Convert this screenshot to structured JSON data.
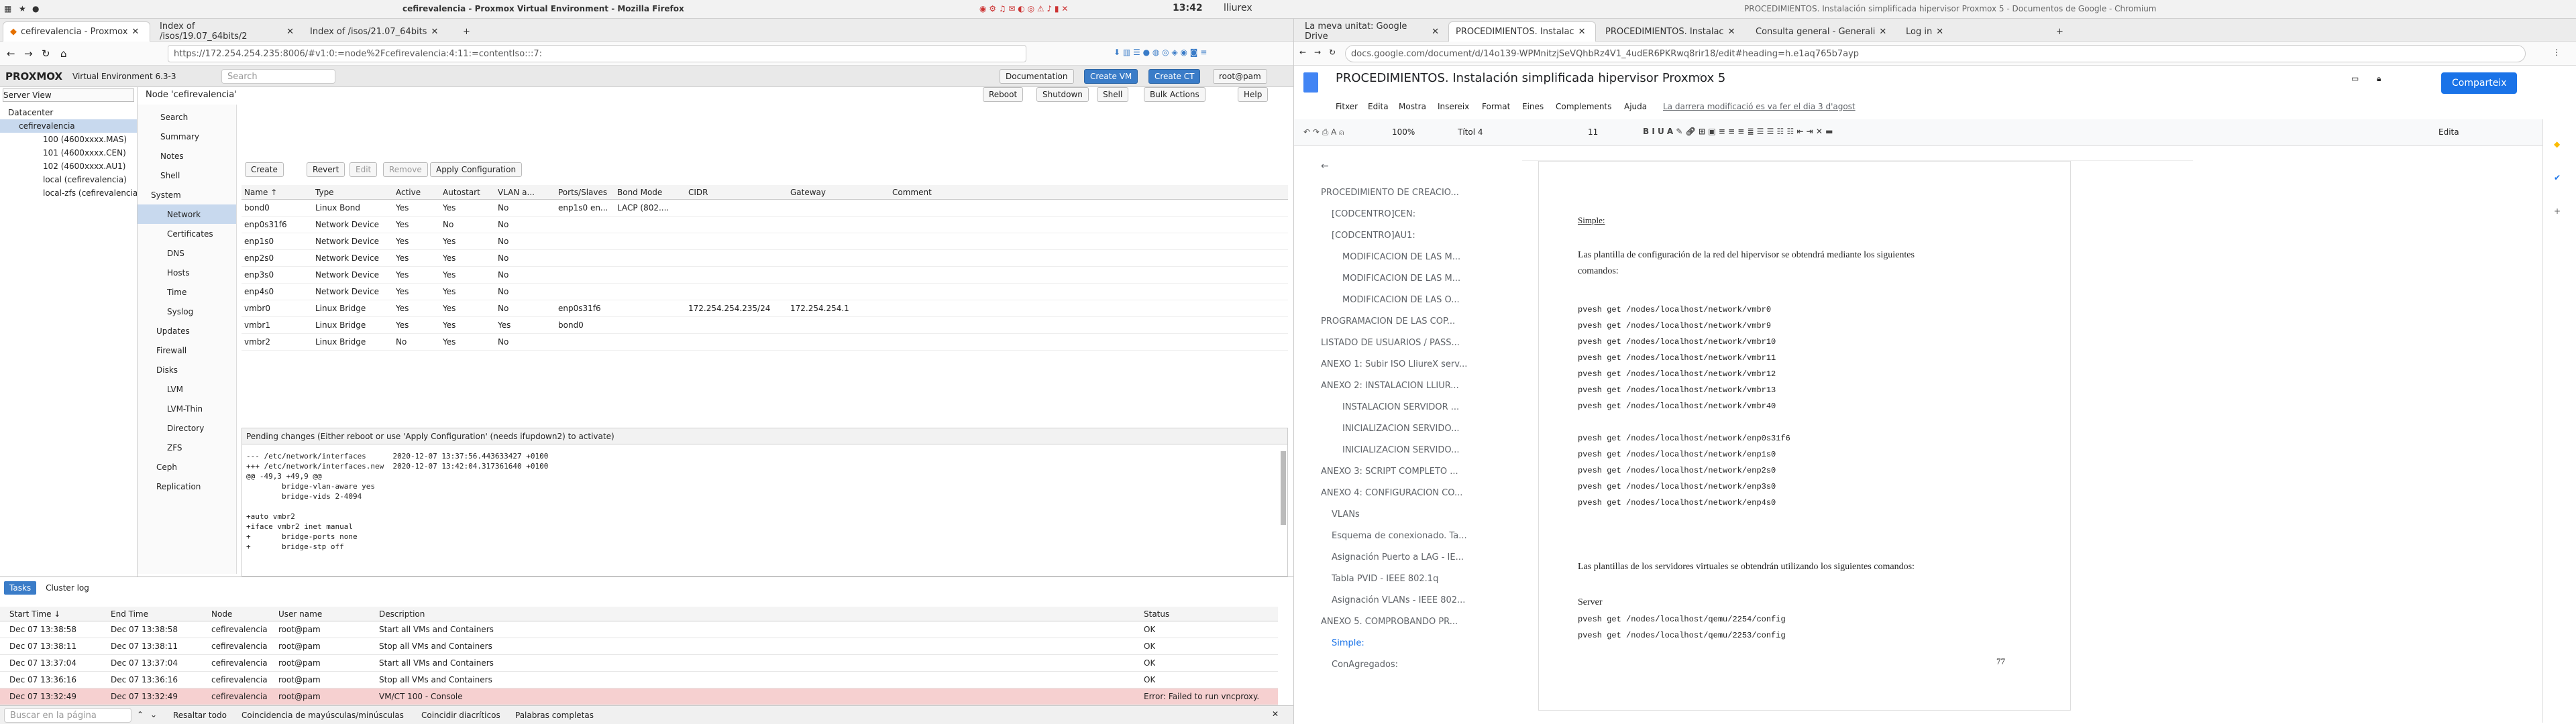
{
  "top_bar": {
    "clock": "13:42",
    "user": "lliurex",
    "window_title_left": "cefirevalencia - Proxmox Virtual Environment - Mozilla Firefox",
    "window_title_right": "PROCEDIMIENTOS. Instalación simplificada hipervisor Proxmox 5 - Documentos de Google - Chromium"
  },
  "firefox": {
    "tabs": [
      "cefirevalencia - Proxmox",
      "Index of /isos/19.07_64bits/2",
      "Index of /isos/21.07_64bits"
    ],
    "url": "https://172.254.254.235:8006/#v1:0:=node%2Fcefirevalencia:4:11:=contentIso:::7:",
    "pve": {
      "brand": "PROXMOX",
      "version": "Virtual Environment 6.3-3",
      "search_placeholder": "Search",
      "buttons": {
        "docs": "Documentation",
        "create_vm": "Create VM",
        "create_ct": "Create CT",
        "user": "root@pam",
        "reboot": "Reboot",
        "shutdown": "Shutdown",
        "shell": "Shell",
        "bulk": "Bulk Actions",
        "help": "Help"
      },
      "view": "Server View",
      "node_title": "Node 'cefirevalencia'",
      "tree": [
        "Datacenter",
        "cefirevalencia",
        "100 (4600xxxx.MAS)",
        "101 (4600xxxx.CEN)",
        "102 (4600xxxx.AU1)",
        "local (cefirevalencia)",
        "local-zfs (cefirevalencia)"
      ],
      "nav": [
        "Search",
        "Summary",
        "Notes",
        "Shell",
        "System",
        "Network",
        "Certificates",
        "DNS",
        "Hosts",
        "Time",
        "Syslog",
        "Updates",
        "Firewall",
        "Disks",
        "LVM",
        "LVM-Thin",
        "Directory",
        "ZFS",
        "Ceph",
        "Replication"
      ],
      "toolbar": {
        "create": "Create",
        "revert": "Revert",
        "edit": "Edit",
        "remove": "Remove",
        "apply": "Apply Configuration"
      },
      "columns": [
        "Name ↑",
        "Type",
        "Active",
        "Autostart",
        "VLAN a...",
        "Ports/Slaves",
        "Bond Mode",
        "CIDR",
        "Gateway",
        "Comment"
      ],
      "rows": [
        [
          "bond0",
          "Linux Bond",
          "Yes",
          "Yes",
          "No",
          "enp1s0 en...",
          "LACP (802....",
          "",
          "",
          ""
        ],
        [
          "enp0s31f6",
          "Network Device",
          "Yes",
          "No",
          "No",
          "",
          "",
          "",
          "",
          ""
        ],
        [
          "enp1s0",
          "Network Device",
          "Yes",
          "Yes",
          "No",
          "",
          "",
          "",
          "",
          ""
        ],
        [
          "enp2s0",
          "Network Device",
          "Yes",
          "Yes",
          "No",
          "",
          "",
          "",
          "",
          ""
        ],
        [
          "enp3s0",
          "Network Device",
          "Yes",
          "Yes",
          "No",
          "",
          "",
          "",
          "",
          ""
        ],
        [
          "enp4s0",
          "Network Device",
          "Yes",
          "Yes",
          "No",
          "",
          "",
          "",
          "",
          ""
        ],
        [
          "vmbr0",
          "Linux Bridge",
          "Yes",
          "Yes",
          "No",
          "enp0s31f6",
          "",
          "172.254.254.235/24",
          "172.254.254.1",
          ""
        ],
        [
          "vmbr1",
          "Linux Bridge",
          "Yes",
          "Yes",
          "Yes",
          "bond0",
          "",
          "",
          "",
          ""
        ],
        [
          "vmbr2",
          "Linux Bridge",
          "No",
          "Yes",
          "No",
          "",
          "",
          "",
          "",
          ""
        ]
      ],
      "pending_title": "Pending changes (Either reboot or use 'Apply Configuration' (needs ifupdown2) to activate)",
      "diff": [
        "--- /etc/network/interfaces      2020-12-07 13:37:56.443633427 +0100",
        "+++ /etc/network/interfaces.new  2020-12-07 13:42:04.317361640 +0100",
        "@@ -49,3 +49,9 @@",
        "        bridge-vlan-aware yes",
        "        bridge-vids 2-4094",
        "",
        "+auto vmbr2",
        "+iface vmbr2 inet manual",
        "+       bridge-ports none",
        "+       bridge-stp off"
      ],
      "task_tabs": [
        "Tasks",
        "Cluster log"
      ],
      "task_cols": [
        "Start Time ↓",
        "End Time",
        "Node",
        "User name",
        "Description",
        "Status"
      ],
      "tasks": [
        [
          "Dec 07 13:38:58",
          "Dec 07 13:38:58",
          "cefirevalencia",
          "root@pam",
          "Start all VMs and Containers",
          "OK"
        ],
        [
          "Dec 07 13:38:11",
          "Dec 07 13:38:11",
          "cefirevalencia",
          "root@pam",
          "Stop all VMs and Containers",
          "OK"
        ],
        [
          "Dec 07 13:37:04",
          "Dec 07 13:37:04",
          "cefirevalencia",
          "root@pam",
          "Start all VMs and Containers",
          "OK"
        ],
        [
          "Dec 07 13:36:16",
          "Dec 07 13:36:16",
          "cefirevalencia",
          "root@pam",
          "Stop all VMs and Containers",
          "OK"
        ],
        [
          "Dec 07 13:32:49",
          "Dec 07 13:32:49",
          "cefirevalencia",
          "root@pam",
          "VM/CT 100 - Console",
          "Error: Failed to run vncproxy."
        ]
      ]
    },
    "find": {
      "placeholder": "Buscar en la página",
      "highlight": "Resaltar todo",
      "case": "Coincidencia de mayúsculas/minúsculas",
      "diacritics": "Coincidir diacríticos",
      "words": "Palabras completas"
    }
  },
  "chromium": {
    "tabs": [
      "La meva unitat: Google Drive",
      "PROCEDIMIENTOS. Instalac",
      "PROCEDIMIENTOS. Instalac",
      "Consulta general - Generali",
      "Log in"
    ],
    "url": "docs.google.com/document/d/14o139-WPMnitzjSeVQhbRz4V1_4udER6PKRwq8rir18/edit#heading=h.e1aq765b7ayp",
    "doc_title": "PROCEDIMIENTOS. Instalación simplificada hipervisor Proxmox 5",
    "menu": [
      "Fitxer",
      "Edita",
      "Mostra",
      "Insereix",
      "Format",
      "Eines",
      "Complements",
      "Ajuda"
    ],
    "last_edit": "La darrera modificació es va fer el dia 3 d'agost",
    "share": "Comparteix",
    "toolbar": {
      "zoom": "100%",
      "style": "Títol 4",
      "font_size": "11",
      "mode": "Edita"
    },
    "outline": [
      "PROCEDIMIENTO DE CREACIÓ...",
      "[CODCENTRO]CEN:",
      "[CODCENTRO]AU1:",
      "MODIFICACIÓN DE LAS M...",
      "MODIFICACIÓN DE LAS M...",
      "MODIFICACIÓN DE LAS O...",
      "PROGRAMACIÓN DE LAS COP...",
      "LISTADO DE USUARIOS / PASS...",
      "ANEXO 1: Subir ISO LliureX serv...",
      "ANEXO 2: INSTALACIÓN LLIUR...",
      "INSTALACIÓN SERVIDOR ...",
      "INICIALIZACIÓN SERVIDO...",
      "INICIALIZACIÓN SERVIDO...",
      "ANEXO 3: SCRIPT COMPLETO ...",
      "ANEXO 4: CONFIGURACIÓN CO...",
      "VLANs",
      "Esquema de conexionado. Ta...",
      "Asignación Puerto a LAG - IE...",
      "Tabla PVID - IEEE 802.1q",
      "Asignación VLANs - IEEE 802...",
      "ANEXO 5. COMPROBANDO PR...",
      "Simple:",
      "ConAgregados:"
    ],
    "page": {
      "heading": "Simple:",
      "p1a": "Las plantilla de configuración de la red del hipervisor se obtendrá mediante los siguientes",
      "p1b": "comandos:",
      "cmds1": [
        "pvesh get /nodes/localhost/network/vmbr0",
        "pvesh get /nodes/localhost/network/vmbr9",
        "pvesh get /nodes/localhost/network/vmbr10",
        "pvesh get /nodes/localhost/network/vmbr11",
        "pvesh get /nodes/localhost/network/vmbr12",
        "pvesh get /nodes/localhost/network/vmbr13",
        "pvesh get /nodes/localhost/network/vmbr40"
      ],
      "cmds2": [
        "pvesh get /nodes/localhost/network/enp0s31f6",
        "pvesh get /nodes/localhost/network/enp1s0",
        "pvesh get /nodes/localhost/network/enp2s0",
        "pvesh get /nodes/localhost/network/enp3s0",
        "pvesh get /nodes/localhost/network/enp4s0"
      ],
      "p2": "Las plantillas de los servidores virtuales se obtendrán utilizando los siguientes comandos:",
      "server": "Server",
      "cmds3": [
        "pvesh get /nodes/localhost/qemu/2254/config",
        "pvesh get /nodes/localhost/qemu/2253/config"
      ],
      "page_num": "77"
    }
  }
}
